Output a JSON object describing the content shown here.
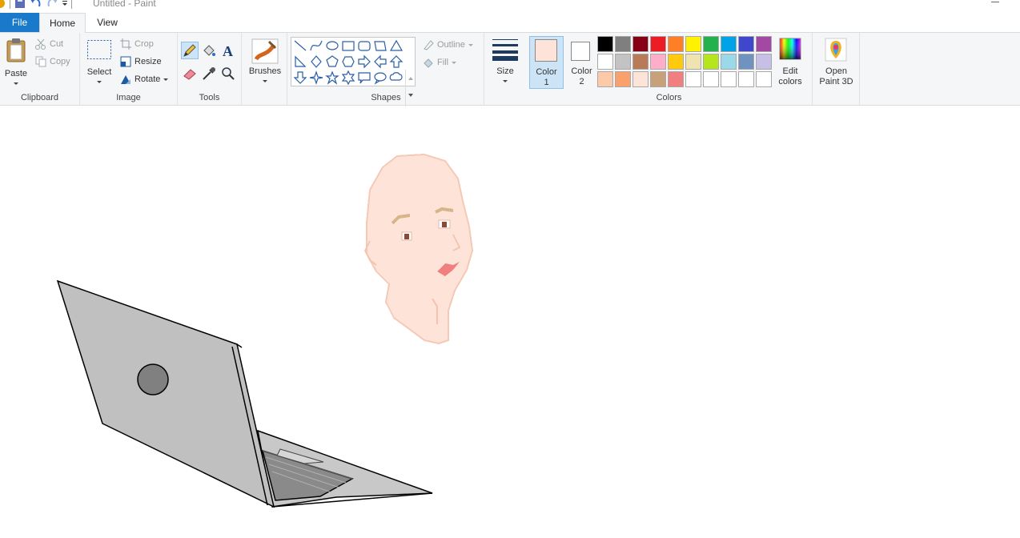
{
  "window": {
    "title": "Untitled - Paint"
  },
  "tabs": {
    "file": "File",
    "home": "Home",
    "view": "View"
  },
  "clipboard": {
    "paste": "Paste",
    "cut": "Cut",
    "copy": "Copy",
    "group": "Clipboard"
  },
  "image": {
    "select": "Select",
    "crop": "Crop",
    "resize": "Resize",
    "rotate": "Rotate",
    "group": "Image"
  },
  "tools": {
    "group": "Tools"
  },
  "brushes": {
    "label": "Brushes"
  },
  "shapes": {
    "outline": "Outline",
    "fill": "Fill",
    "group": "Shapes"
  },
  "size": {
    "label": "Size"
  },
  "colors": {
    "color1_label_a": "Color",
    "color1_label_b": "1",
    "color2_label_a": "Color",
    "color2_label_b": "2",
    "edit_a": "Edit",
    "edit_b": "colors",
    "group": "Colors",
    "color1": "#fde3d8",
    "color2": "#ffffff",
    "palette_row1": [
      "#000000",
      "#7f7f7f",
      "#880015",
      "#ed1c24",
      "#ff7f27",
      "#fff200",
      "#22b14c",
      "#00a2e8",
      "#3f48cc",
      "#a349a4"
    ],
    "palette_row2": [
      "#ffffff",
      "#c3c3c3",
      "#b97a57",
      "#ffaec9",
      "#ffc90e",
      "#efe4b0",
      "#b5e61d",
      "#99d9ea",
      "#7092be",
      "#c8bfe7"
    ],
    "palette_row3": [
      "#fcc9a9",
      "#f9a06c",
      "#fde3d8",
      "#c8a07a",
      "#f08080",
      "#ffffff",
      "#ffffff",
      "#ffffff",
      "#ffffff",
      "#ffffff"
    ]
  },
  "paint3d": {
    "label_a": "Open",
    "label_b": "Paint 3D"
  }
}
